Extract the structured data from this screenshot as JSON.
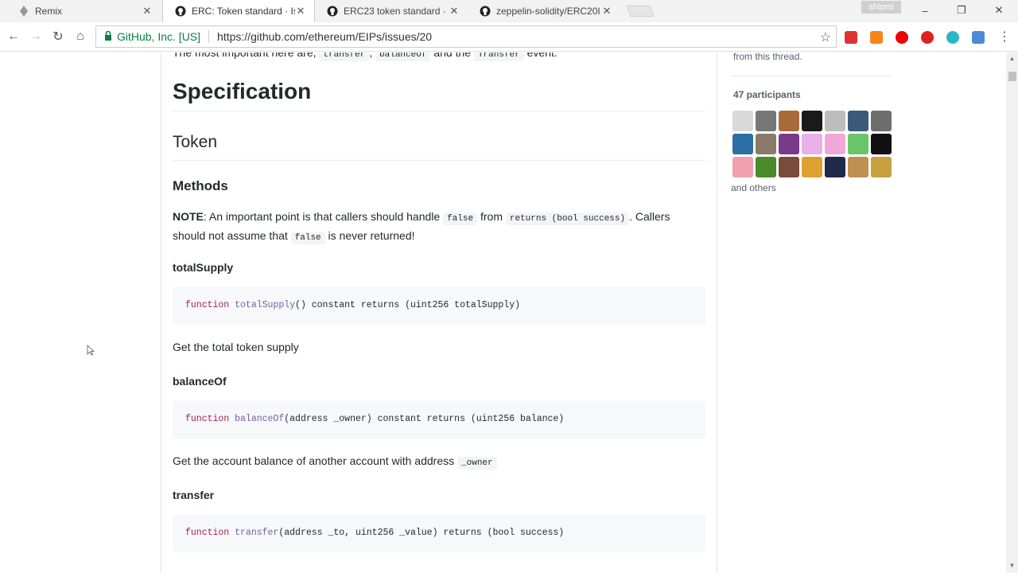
{
  "browser": {
    "tabs": [
      {
        "title": "Remix",
        "icon": "remix-icon"
      },
      {
        "title": "ERC: Token standard · Iss",
        "icon": "github-icon",
        "active": true
      },
      {
        "title": "ERC23 token standard · I",
        "icon": "github-icon"
      },
      {
        "title": "zeppelin-solidity/ERC20I",
        "icon": "github-icon"
      }
    ],
    "profile": "shlomi",
    "org": "GitHub, Inc. [US]",
    "url": "https://github.com/ethereum/EIPs/issues/20"
  },
  "article": {
    "top_text_prefix": "The most important here are, ",
    "top_code_1": "transfer",
    "top_code_2": "balanceOf",
    "top_text_mid": " and the ",
    "top_code_3": "Transfer",
    "top_text_suffix": " event.",
    "spec_heading": "Specification",
    "token_heading": "Token",
    "methods_heading": "Methods",
    "note_label": "NOTE",
    "note_part1": ": An important point is that callers should handle ",
    "note_code1": "false",
    "note_part2": " from ",
    "note_code2": "returns (bool success)",
    "note_part3": ". Callers should not assume that ",
    "note_code3": "false",
    "note_part4": " is never returned!",
    "methods": [
      {
        "name": "totalSupply",
        "kw": "function",
        "fn": "totalSupply",
        "sig": "() constant returns (uint256 totalSupply)",
        "desc": "Get the total token supply",
        "desc_code": ""
      },
      {
        "name": "balanceOf",
        "kw": "function",
        "fn": "balanceOf",
        "sig": "(address _owner) constant returns (uint256 balance)",
        "desc": "Get the account balance of another account with address ",
        "desc_code": "_owner"
      },
      {
        "name": "transfer",
        "kw": "function",
        "fn": "transfer",
        "sig": "(address _to, uint256 _value) returns (bool success)"
      }
    ]
  },
  "sidebar": {
    "from_thread": "from this thread.",
    "participants_label": "47 participants",
    "and_others": "and others",
    "avatar_colors": [
      "#d9d9d9",
      "#777777",
      "#a86b3c",
      "#1a1a1a",
      "#bdbdbd",
      "#3b5a7a",
      "#6d6d6d",
      "#2d6ea3",
      "#8a7a6a",
      "#7a3a8a",
      "#e8b0e8",
      "#f0a8d8",
      "#6ac46a",
      "#111111",
      "#f0a0b0",
      "#4a8a2a",
      "#7a4a3a",
      "#e0a030",
      "#202a4a",
      "#c09050",
      "#c8a040"
    ]
  }
}
